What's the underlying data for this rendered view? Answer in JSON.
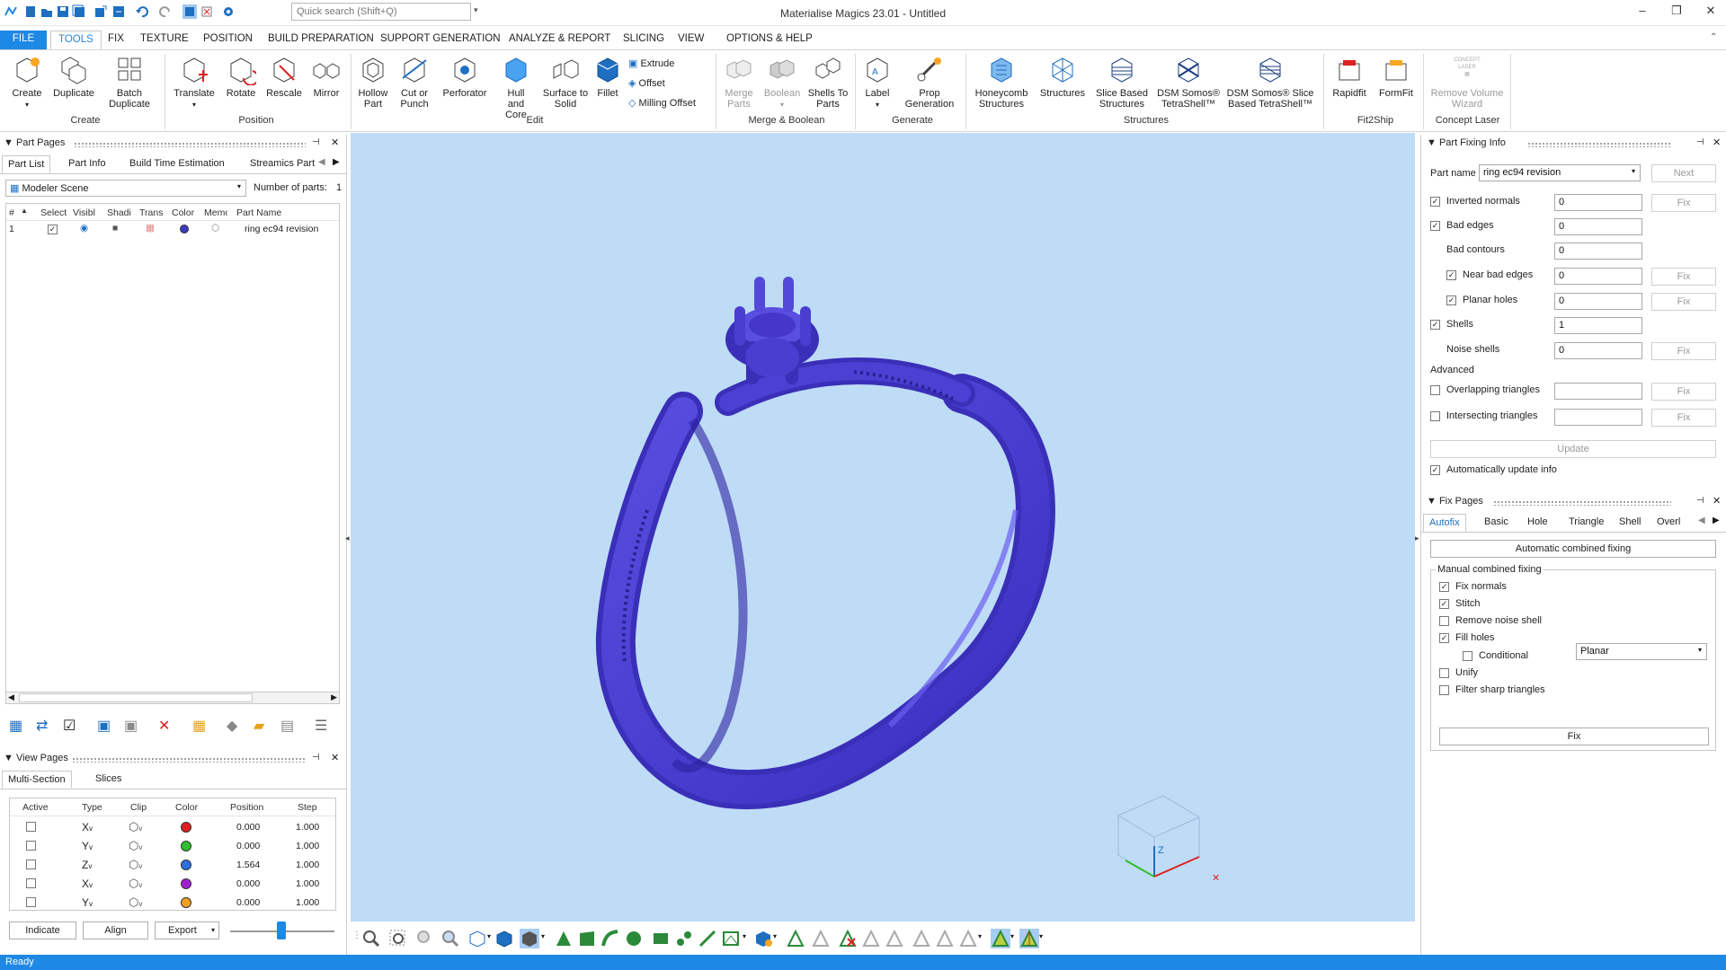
{
  "app": {
    "title": "Materialise Magics 23.01 - Untitled",
    "search_placeholder": "Quick search (Shift+Q)",
    "window_controls": {
      "minimize": "–",
      "restore": "❐",
      "close": "✕"
    }
  },
  "menu_tabs": [
    "FILE",
    "TOOLS",
    "FIX",
    "TEXTURE",
    "POSITION",
    "BUILD PREPARATION",
    "SUPPORT GENERATION",
    "ANALYZE & REPORT",
    "SLICING",
    "VIEW",
    "OPTIONS & HELP"
  ],
  "active_tab": "TOOLS",
  "ribbon": {
    "create_group": {
      "label": "Create",
      "buttons": [
        "Create",
        "Duplicate",
        "Batch Duplicate"
      ]
    },
    "position_group": {
      "label": "Position",
      "buttons": [
        "Translate",
        "Rotate",
        "Rescale",
        "Mirror"
      ]
    },
    "edit_group": {
      "label": "Edit",
      "buttons": [
        "Hollow Part",
        "Cut or Punch",
        "Perforator",
        "Hull and Core",
        "Surface to Solid",
        "Fillet"
      ],
      "small": [
        "Extrude",
        "Offset",
        "Milling Offset"
      ]
    },
    "merge_group": {
      "label": "Merge & Boolean",
      "buttons": [
        "Merge Parts",
        "Boolean",
        "Shells To Parts"
      ]
    },
    "generate_group": {
      "label": "Generate",
      "buttons": [
        "Label",
        "Prop Generation"
      ]
    },
    "structures_group": {
      "label": "Structures",
      "buttons": [
        "Honeycomb Structures",
        "Structures",
        "Slice Based Structures",
        "DSM Somos® TetraShell™",
        "DSM Somos® Slice Based TetraShell™"
      ]
    },
    "fit2ship_group": {
      "label": "Fit2Ship",
      "buttons": [
        "Rapidfit",
        "FormFit"
      ]
    },
    "concept_group": {
      "label": "Concept Laser",
      "buttons": [
        "Remove Volume Wizard"
      ],
      "icon_text": "CONCEPT LASER"
    }
  },
  "part_pages": {
    "title": "Part Pages",
    "tabs": [
      "Part List",
      "Part Info",
      "Build Time Estimation",
      "Streamics Part"
    ],
    "scene": "Modeler Scene",
    "number_of_parts_label": "Number of parts:",
    "number_of_parts": "1",
    "columns": [
      "#",
      "Select",
      "Visibl",
      "Shadi",
      "Trans",
      "Color",
      "Memo",
      "Part Name"
    ],
    "rows": [
      {
        "index": "1",
        "part_name": "ring ec94 revision",
        "color": "#3b3bc2"
      }
    ]
  },
  "view_pages": {
    "title": "View Pages",
    "tabs": [
      "Multi-Section",
      "Slices"
    ],
    "columns": [
      "Active",
      "Type",
      "Clip",
      "Color",
      "Position",
      "Step"
    ],
    "rows": [
      {
        "type": "X",
        "color": "#e02020",
        "position": "0.000",
        "step": "1.000"
      },
      {
        "type": "Y",
        "color": "#2ec02e",
        "position": "0.000",
        "step": "1.000"
      },
      {
        "type": "Z",
        "color": "#2a6ee0",
        "position": "1.564",
        "step": "1.000"
      },
      {
        "type": "X",
        "color": "#a020d0",
        "position": "0.000",
        "step": "1.000"
      },
      {
        "type": "Y",
        "color": "#f0a020",
        "position": "0.000",
        "step": "1.000"
      }
    ],
    "buttons": {
      "indicate": "Indicate",
      "align": "Align",
      "export": "Export"
    }
  },
  "part_fixing_info": {
    "title": "Part Fixing Info",
    "part_name_label": "Part name",
    "part_name": "ring ec94 revision",
    "next_label": "Next",
    "fix_label": "Fix",
    "rows": [
      {
        "label": "Inverted normals",
        "value": "0",
        "checkbox": true,
        "checked": true,
        "fix": true
      },
      {
        "label": "Bad edges",
        "value": "0",
        "checkbox": true,
        "checked": true,
        "fix": false
      },
      {
        "label": "Bad contours",
        "value": "0",
        "checkbox": false,
        "checked": false,
        "fix": false
      },
      {
        "label": "Near bad edges",
        "value": "0",
        "checkbox": true,
        "checked": true,
        "fix": true
      },
      {
        "label": "Planar holes",
        "value": "0",
        "checkbox": true,
        "checked": true,
        "fix": true
      },
      {
        "label": "Shells",
        "value": "1",
        "checkbox": true,
        "checked": true,
        "fix": false
      },
      {
        "label": "Noise shells",
        "value": "0",
        "checkbox": false,
        "checked": false,
        "fix": true
      }
    ],
    "advanced_label": "Advanced",
    "advanced_rows": [
      {
        "label": "Overlapping triangles",
        "value": ""
      },
      {
        "label": "Intersecting triangles",
        "value": ""
      }
    ],
    "update_label": "Update",
    "auto_update_label": "Automatically update info"
  },
  "fix_pages": {
    "title": "Fix Pages",
    "tabs": [
      "Autofix",
      "Basic",
      "Hole",
      "Triangle",
      "Shell",
      "Overl"
    ],
    "auto_combined_label": "Automatic combined fixing",
    "manual_label": "Manual combined fixing",
    "options": [
      {
        "label": "Fix normals",
        "checked": true
      },
      {
        "label": "Stitch",
        "checked": true
      },
      {
        "label": "Remove noise shell",
        "checked": false
      },
      {
        "label": "Fill holes",
        "checked": true
      },
      {
        "label": "Conditional",
        "checked": false
      },
      {
        "label": "Unify",
        "checked": false
      },
      {
        "label": "Filter sharp triangles",
        "checked": false
      }
    ],
    "fill_mode": "Planar",
    "fix_button": "Fix"
  },
  "viewport": {
    "background": "#bfdcf7",
    "model_color": "#4a3ed0",
    "axis_labels": {
      "x": "✕",
      "z": "Z"
    }
  },
  "status": {
    "text": "Ready"
  }
}
